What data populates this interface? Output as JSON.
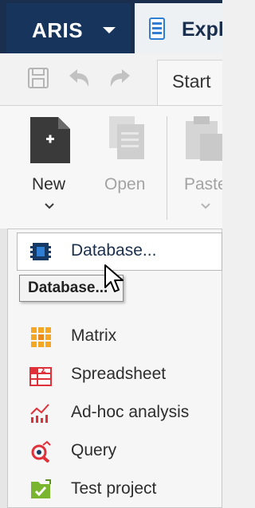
{
  "titlebar": {
    "app_menu_label": "ARIS",
    "explorer_tab_label": "Expl"
  },
  "quick_access": {
    "icons": [
      "save-icon",
      "undo-icon",
      "redo-icon"
    ]
  },
  "tabs": {
    "start_label": "Start"
  },
  "ribbon": {
    "new_label": "New",
    "open_label": "Open",
    "paste_label": "Paste"
  },
  "new_menu": {
    "items": [
      {
        "label": "Database...",
        "icon": "database-icon",
        "highlighted": true
      },
      {
        "label": "Matrix",
        "icon": "matrix-icon"
      },
      {
        "label": "Spreadsheet",
        "icon": "spreadsheet-icon"
      },
      {
        "label": "Ad-hoc analysis",
        "icon": "adhoc-analysis-icon"
      },
      {
        "label": "Query",
        "icon": "query-icon"
      },
      {
        "label": "Test project",
        "icon": "test-project-icon"
      }
    ],
    "tooltip": "Database..."
  },
  "colors": {
    "titlebar_bg": "#1a2f4d",
    "app_menu_bg": "#16345c",
    "accent_blue": "#2e7fd4",
    "matrix_orange": "#f5a623",
    "red": "#e0313a",
    "green": "#79b52e"
  }
}
